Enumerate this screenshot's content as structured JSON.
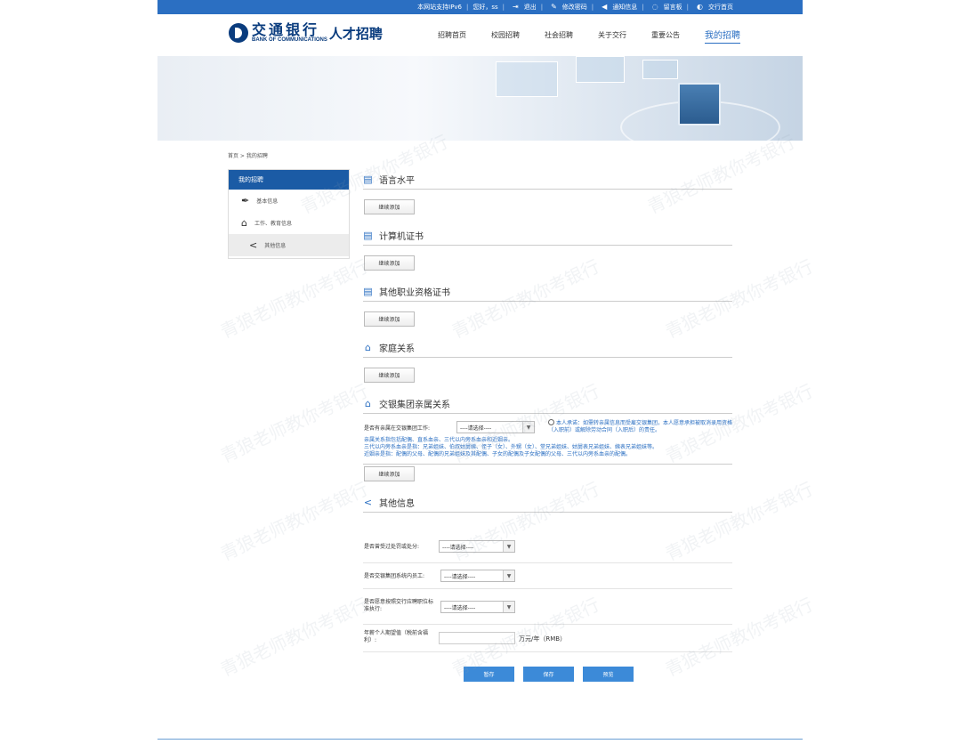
{
  "topbar": {
    "ipv6": "本网站支持IPv6",
    "greeting": "您好，ss",
    "logout": "退出",
    "change_password": "修改密码",
    "notices": "通知信息",
    "message_board": "留言板",
    "home": "交行首页"
  },
  "brand": {
    "name_cn": "交通银行",
    "name_en": "BANK OF COMMUNICATIONS",
    "subtitle": "人才招聘"
  },
  "nav": [
    {
      "label": "招聘首页"
    },
    {
      "label": "校园招聘"
    },
    {
      "label": "社会招聘"
    },
    {
      "label": "关于交行"
    },
    {
      "label": "重要公告"
    },
    {
      "label": "我的招聘",
      "active": true
    }
  ],
  "breadcrumb": "首页 > 我的招聘",
  "sidebar": {
    "header": "我的招聘",
    "items": [
      {
        "label": "基本信息",
        "icon": "pen-icon"
      },
      {
        "label": "工作、教育信息",
        "icon": "edit-house-icon"
      },
      {
        "label": "其他信息",
        "icon": "share-icon",
        "selected": true
      }
    ]
  },
  "sections": {
    "language": "语言水平",
    "computer": "计算机证书",
    "vocational": "其他职业资格证书",
    "family": "家庭关系",
    "group_family": "交银集团亲属关系",
    "other": "其他信息"
  },
  "add_label": "继续添加",
  "group_family_form": {
    "question": "是否有亲属在交银集团工作:",
    "select_value": "----请选择----",
    "promise": "本人承诺：如需转亲属信息而受雇交银集团，本人愿意承担被取消录用资格（入职前）或解除劳动合同（入职后）的责任。",
    "note_lines": [
      "亲属关系指包括配偶、直系血亲、三代以内旁系血亲和近姻亲。",
      "三代以内旁系血亲是指：兄弟姐妹、伯叔姑舅姨、侄子（女）、外甥（女）、堂兄弟姐妹、姑舅表兄弟姐妹、姨表兄弟姐妹等。",
      "近姻亲是指：配偶的父母、配偶的兄弟姐妹及其配偶、子女的配偶及子女配偶的父母、三代以内旁系血亲的配偶。"
    ]
  },
  "other_form": {
    "punished_label": "是否曾受过处罚或处分:",
    "punished_value": "----请选择----",
    "employee_label": "是否交银集团系统内员工:",
    "employee_value": "----请选择----",
    "obey_label": "是否愿意按照交行应聘职位标准执行:",
    "obey_value": "----请选择----",
    "salary_label": "年薪个人期望值（税前含福利）:",
    "salary_value": "",
    "salary_unit": "万元/年（RMB）"
  },
  "actions": {
    "draft": "暂存",
    "save": "保存",
    "preview": "预览"
  },
  "watermark": "青狼老师教你考银行",
  "colors": {
    "topbar": "#2b6fc2",
    "brand": "#0a3c7e",
    "sidebar_header": "#1b5ba5",
    "button": "#3c8ad8"
  }
}
